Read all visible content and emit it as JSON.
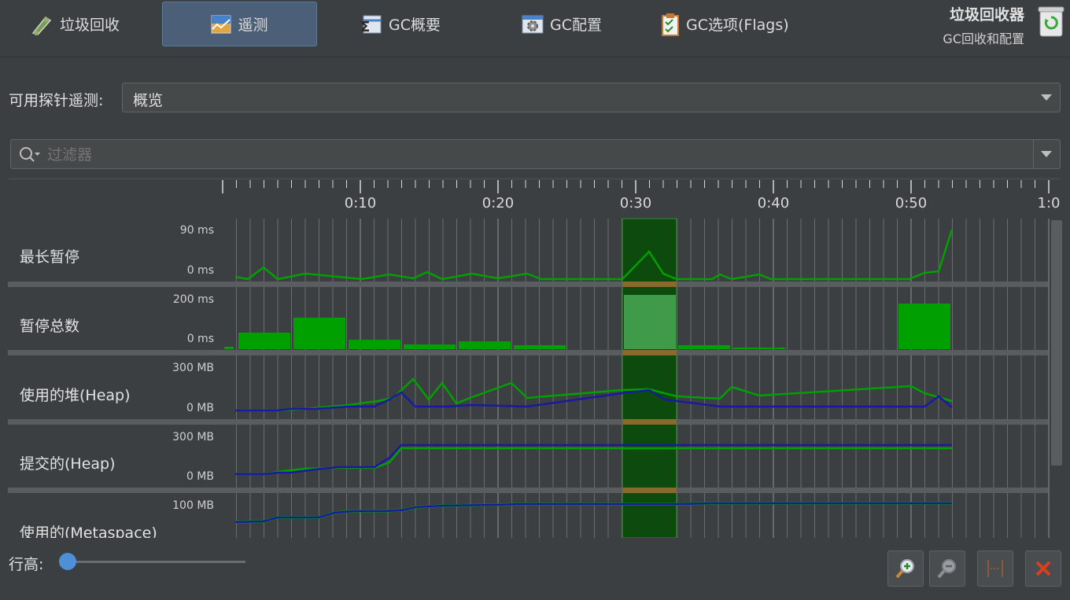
{
  "tabs": [
    {
      "label": "垃圾回收",
      "icon": "recycle-cart-icon"
    },
    {
      "label": "遥测",
      "icon": "telemetry-chart-icon",
      "active": true
    },
    {
      "label": "GC概要",
      "icon": "sigma-table-icon"
    },
    {
      "label": "GC配置",
      "icon": "gear-window-icon"
    },
    {
      "label": "GC选项(Flags)",
      "icon": "clipboard-check-icon"
    }
  ],
  "brand": {
    "title": "垃圾回收器",
    "subtitle": "GC回收和配置",
    "icon": "recycle-bin-icon"
  },
  "probe": {
    "label": "可用探针遥测:",
    "selected": "概览"
  },
  "filter": {
    "placeholder": "过滤器"
  },
  "timeline": {
    "tick_labels": [
      "0:10",
      "0:20",
      "0:30",
      "0:40",
      "0:50",
      "1:0"
    ],
    "selection_range": [
      "0:29",
      "0:33"
    ]
  },
  "rows": [
    {
      "label": "最长暂停",
      "scale_max": "90 ms",
      "scale_min": "0 ms"
    },
    {
      "label": "暂停总数",
      "scale_max": "200 ms",
      "scale_min": "0 ms"
    },
    {
      "label": "使用的堆(Heap)",
      "scale_max": "300 MB",
      "scale_min": "0 MB"
    },
    {
      "label": "提交的(Heap)",
      "scale_max": "300 MB",
      "scale_min": "0 MB"
    },
    {
      "label": "使用的(Metaspace)",
      "scale_max": "100 MB",
      "scale_min": ""
    }
  ],
  "colors": {
    "green": "#00a000",
    "blue": "#1a1aa0",
    "selection": "#0d4a0d",
    "bg": "#3c3f41"
  },
  "row_height": {
    "label": "行高:",
    "value": 0
  },
  "tools": [
    {
      "name": "zoom-in",
      "icon": "zoom-in-icon"
    },
    {
      "name": "zoom-out",
      "icon": "zoom-out-icon"
    },
    {
      "name": "fit",
      "icon": "fit-range-icon"
    },
    {
      "name": "close",
      "icon": "close-icon"
    }
  ]
}
